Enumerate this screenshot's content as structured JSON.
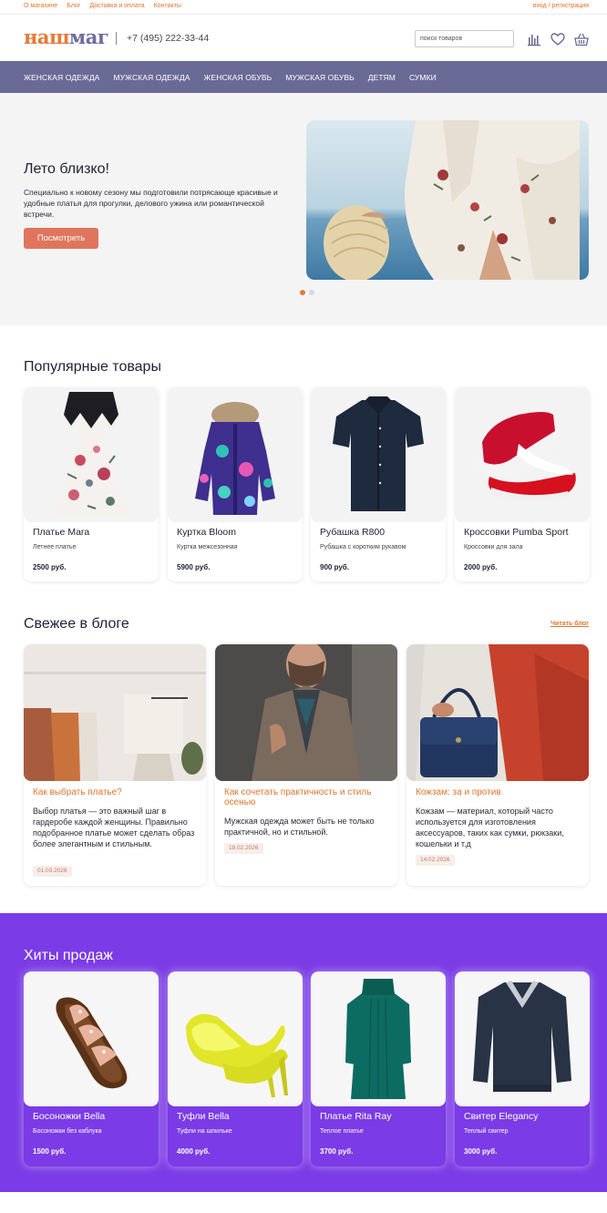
{
  "topbar": {
    "links": [
      "О магазине",
      "Блог",
      "Доставка и оплата",
      "Контакты"
    ],
    "login": "вход / регистрация"
  },
  "header": {
    "logo_part1": "наш",
    "logo_part2": "маг",
    "phone": "+7 (495) 222-33-44",
    "search_placeholder": "поиск товаров",
    "icons": [
      "stats-icon",
      "heart-icon",
      "basket-icon"
    ]
  },
  "nav": {
    "items": [
      "Женская одежда",
      "Мужская одежда",
      "Женская обувь",
      "Мужская обувь",
      "Детям",
      "Сумки"
    ]
  },
  "hero": {
    "title": "Лето близко!",
    "text": "Специально к новому сезону мы подготовили потрясающе красивые и удобные платья для прогулки, делового ужина или романтической встречи.",
    "button": "Посмотреть",
    "slides_total": 2,
    "active_slide": 1
  },
  "popular": {
    "title": "Популярные товары",
    "items": [
      {
        "name": "Платье Mara",
        "desc": "Летнее платье",
        "price": "2500 руб."
      },
      {
        "name": "Куртка Bloom",
        "desc": "Куртка межсезонная",
        "price": "5900 руб."
      },
      {
        "name": "Рубашка R800",
        "desc": "Рубашка с коротким рукавом",
        "price": "900 руб."
      },
      {
        "name": "Кроссовки Pumba Sport",
        "desc": "Кроссовки для зала",
        "price": "2000 руб."
      }
    ]
  },
  "blog": {
    "title": "Свежее в блоге",
    "link": "Читать блог",
    "posts": [
      {
        "title": "Как выбрать платье?",
        "text": "Выбор платья — это важный шаг в гардеробе каждой женщины. Правильно подобранное платье может сделать образ более элегантным и стильным.",
        "date": "01.03.2026"
      },
      {
        "title": "Как сочетать практичность и стиль осенью",
        "text": "Мужская одежда может быть не только практичной, но и стильной.",
        "date": "18.02.2026"
      },
      {
        "title": "Кожзам: за и против",
        "text": "Кожзам — материал, который часто используется для изготовления аксессуаров, таких как сумки, рюкзаки, кошельки и т.д",
        "date": "14.02.2026"
      }
    ]
  },
  "hits": {
    "title": "Хиты продаж",
    "items": [
      {
        "name": "Босоножки Bella",
        "desc": "Босоножки без каблука",
        "price": "1500 руб."
      },
      {
        "name": "Туфли Bella",
        "desc": "Туфли на шпильке",
        "price": "4000 руб."
      },
      {
        "name": "Платье Rita Ray",
        "desc": "Теплое платье",
        "price": "3700 руб."
      },
      {
        "name": "Свитер Elegancy",
        "desc": "Теплый свитер",
        "price": "3000 руб."
      }
    ]
  },
  "colors": {
    "accent": "#e0752d",
    "nav": "#6a6a96",
    "hits_bg": "#7b3be6",
    "button": "#e0755d"
  }
}
